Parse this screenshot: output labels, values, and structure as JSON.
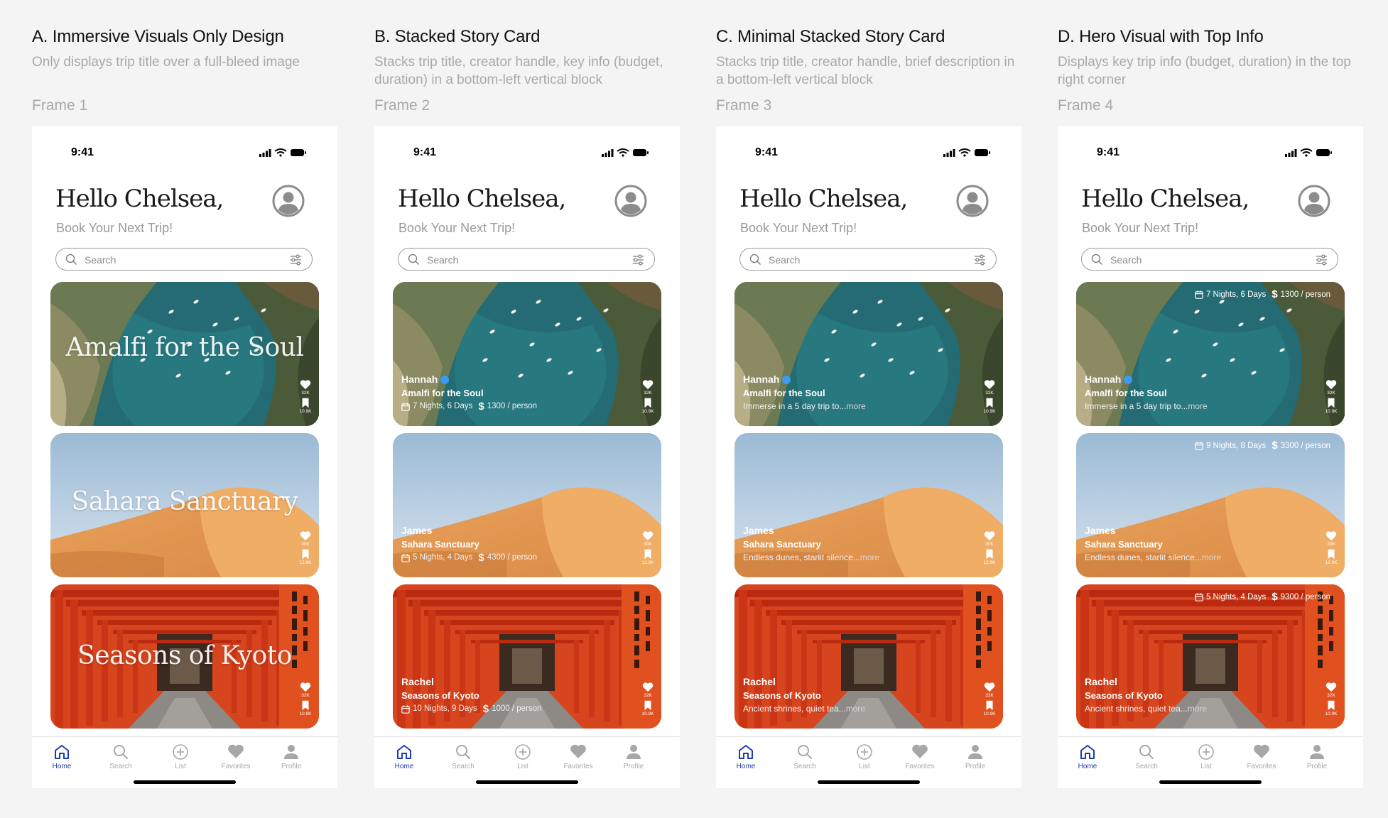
{
  "variants": [
    {
      "title": "A. Immersive Visuals Only Design",
      "description": "Only displays trip title over a full-bleed image",
      "frame_label": "Frame 1",
      "trips": [
        {
          "overlay_title": "Amalfi for the Soul",
          "likes": "32K",
          "saves": "10.9K"
        },
        {
          "overlay_title": "Sahara Sanctuary",
          "likes": "30K",
          "saves": "12.9K"
        },
        {
          "overlay_title": "Seasons of Kyoto",
          "likes": "32K",
          "saves": "10.9K"
        }
      ]
    },
    {
      "title": "B. Stacked Story Card",
      "description": "Stacks trip title, creator handle, key info (budget, duration) in a bottom-left vertical block",
      "frame_label": "Frame 2",
      "trips": [
        {
          "creator": "Hannah",
          "name": "Amalfi for the Soul",
          "duration": "7 Nights, 6 Days",
          "budget": "1300 / person",
          "likes": "32K",
          "saves": "10.9K"
        },
        {
          "creator": "James",
          "name": "Sahara Sanctuary",
          "duration": "5 Nights, 4 Days",
          "budget": "4300 / person",
          "likes": "30K",
          "saves": "12.9K"
        },
        {
          "creator": "Rachel",
          "name": "Seasons of Kyoto",
          "duration": "10 Nights, 9 Days",
          "budget": "1000 / person",
          "likes": "32K",
          "saves": "10.9K"
        }
      ]
    },
    {
      "title": "C. Minimal Stacked Story Card",
      "description": "Stacks trip title, creator handle, brief description in a bottom-left vertical block",
      "frame_label": "Frame 3",
      "trips": [
        {
          "creator": "Hannah",
          "name": "Amalfi for the Soul",
          "desc": "Immerse in a 5 day trip to...",
          "more": "more",
          "likes": "32K",
          "saves": "10.9K"
        },
        {
          "creator": "James",
          "name": "Sahara Sanctuary",
          "desc": "Endless dunes, starlit silence...",
          "more": "more",
          "likes": "30K",
          "saves": "12.9K"
        },
        {
          "creator": "Rachel",
          "name": "Seasons of Kyoto",
          "desc": "Ancient shrines, quiet tea...",
          "more": "more",
          "likes": "32K",
          "saves": "10.9K"
        }
      ]
    },
    {
      "title": "D. Hero Visual with Top Info",
      "description": "Displays key trip info (budget, duration) in the top right corner",
      "frame_label": "Frame 4",
      "trips": [
        {
          "creator": "Hannah",
          "name": "Amalfi for the Soul",
          "desc": "Immerse in a 5 day trip to...",
          "more": "more",
          "duration": "7 Nights, 6 Days",
          "budget": "1300 / person",
          "likes": "32K",
          "saves": "10.9K"
        },
        {
          "creator": "James",
          "name": "Sahara Sanctuary",
          "desc": "Endless dunes, starlit silence...",
          "more": "more",
          "duration": "9 Nights, 8 Days",
          "budget": "3300 / person",
          "likes": "30K",
          "saves": "12.9K"
        },
        {
          "creator": "Rachel",
          "name": "Seasons of Kyoto",
          "desc": "Ancient shrines, quiet tea...",
          "more": "more",
          "duration": "5 Nights, 4 Days",
          "budget": "9300 / person",
          "likes": "32K",
          "saves": "10.9K"
        }
      ]
    }
  ],
  "phone": {
    "time": "9:41",
    "greeting": "Hello Chelsea,",
    "subtitle": "Book Your Next Trip!",
    "search_placeholder": "Search",
    "currency_symbol": "$",
    "tabs": [
      {
        "label": "Home",
        "icon": "home-icon",
        "active": true
      },
      {
        "label": "Search",
        "icon": "search-icon",
        "active": false
      },
      {
        "label": "List",
        "icon": "plus-circle-icon",
        "active": false
      },
      {
        "label": "Favorites",
        "icon": "heart-icon",
        "active": false
      },
      {
        "label": "Profile",
        "icon": "person-icon",
        "active": false
      }
    ]
  },
  "colors": {
    "active_tab": "#1e3bb5",
    "verified_badge": "#3b9bf0"
  }
}
